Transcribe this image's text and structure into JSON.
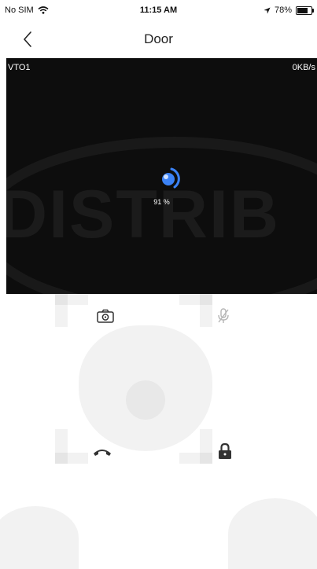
{
  "status_bar": {
    "carrier": "No SIM",
    "time": "11:15 AM",
    "battery_percent": "78%",
    "battery_level": 0.78
  },
  "nav": {
    "title": "Door",
    "back_icon": "chevron-left-icon"
  },
  "video": {
    "device_name": "VTO1",
    "bitrate": "0KB/s",
    "loading_percent": "91 %",
    "spinner_color": "#3b82f6",
    "watermark": "DISTRIB"
  },
  "controls": {
    "snapshot_icon": "camera-icon",
    "mic_icon": "mic-off-icon",
    "hangup_icon": "phone-hangup-icon",
    "unlock_icon": "lock-icon"
  }
}
